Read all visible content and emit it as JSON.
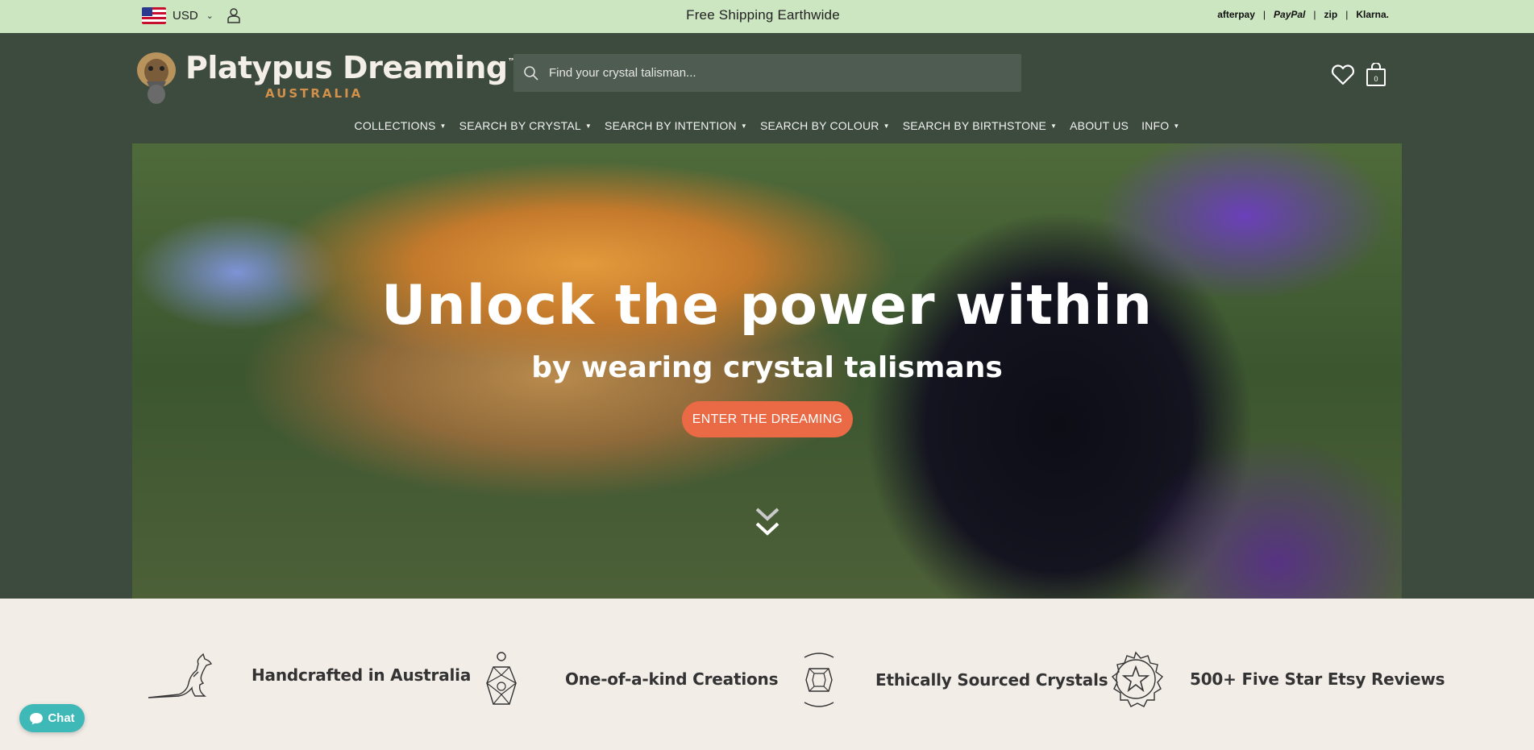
{
  "topbar": {
    "currency": "USD",
    "shipping": "Free Shipping Earthwide",
    "payments": [
      "afterpay",
      "PayPal",
      "zip",
      "Klarna."
    ]
  },
  "header": {
    "logo_title": "Platypus Dreaming",
    "logo_tm": "™",
    "logo_sub": "AUSTRALIA",
    "search_placeholder": "Find your crystal talisman..."
  },
  "nav": {
    "items": [
      {
        "label": "COLLECTIONS",
        "dropdown": true
      },
      {
        "label": "SEARCH BY CRYSTAL",
        "dropdown": true
      },
      {
        "label": "SEARCH BY INTENTION",
        "dropdown": true
      },
      {
        "label": "SEARCH BY COLOUR",
        "dropdown": true
      },
      {
        "label": "SEARCH BY BIRTHSTONE",
        "dropdown": true
      },
      {
        "label": "ABOUT US",
        "dropdown": false
      },
      {
        "label": "INFO",
        "dropdown": true
      }
    ]
  },
  "hero": {
    "title": "Unlock the power within",
    "subtitle": "by wearing crystal talismans",
    "cta": "ENTER THE DREAMING"
  },
  "features": [
    {
      "label": "Handcrafted in Australia",
      "icon": "kangaroo-icon"
    },
    {
      "label": "One-of-a-kind Creations",
      "icon": "pendant-icon"
    },
    {
      "label": "Ethically Sourced Crystals",
      "icon": "hands-crystal-icon"
    },
    {
      "label": "500+ Five Star Etsy Reviews",
      "icon": "star-badge-icon"
    }
  ],
  "chat": {
    "label": "Chat"
  },
  "colors": {
    "topbar": "#cde6c2",
    "header": "#3d4a3e",
    "accent_teal": "#2f6a6a",
    "cta": "#ea6a45",
    "chat": "#3fb8b8",
    "features_bg": "#f3ede8",
    "logo_sub": "#d2914a"
  }
}
